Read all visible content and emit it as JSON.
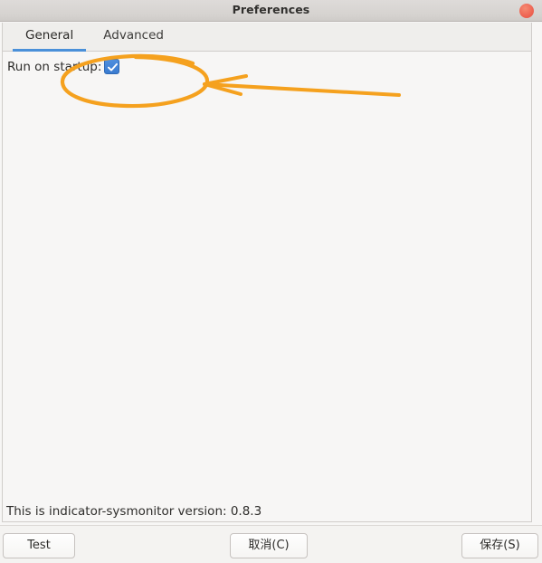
{
  "window": {
    "title": "Preferences",
    "close_icon": "close-circle-icon",
    "close_color": "#ee6352"
  },
  "tabs": [
    {
      "label": "General",
      "active": true
    },
    {
      "label": "Advanced",
      "active": false
    }
  ],
  "general_page": {
    "startup_label": "Run on startup:",
    "startup_checked": true,
    "checkbox_color": "#3a7bd0",
    "check_icon": "check-mark-icon"
  },
  "status": {
    "text": "This is indicator-sysmonitor version: 0.8.3"
  },
  "actions": {
    "test_label": "Test",
    "cancel_label": "取消(C)",
    "save_label": "保存(S)"
  },
  "annotation": {
    "color": "#f5a11e",
    "ellipse_name": "highlight-ellipse",
    "arrow_name": "pointer-arrow"
  }
}
